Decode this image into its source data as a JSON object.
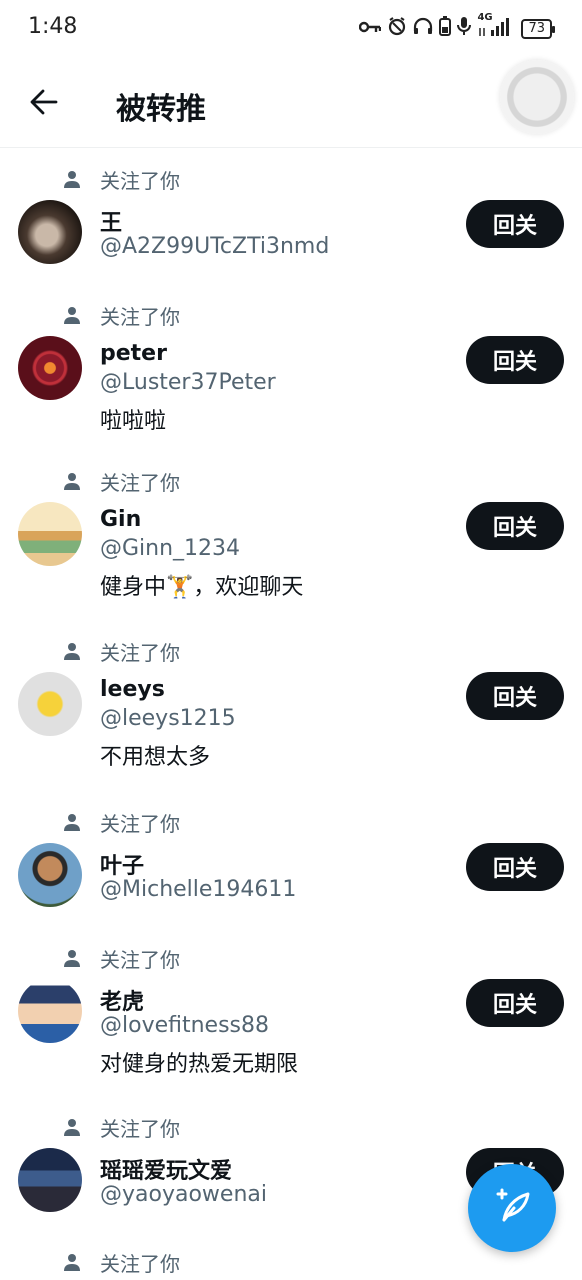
{
  "status_bar": {
    "time": "1:48",
    "network": "4G",
    "battery": "73",
    "icons": [
      "key-icon",
      "alarm-icon",
      "headphones-icon",
      "battery-saver-icon",
      "mic-icon",
      "signal-icon",
      "battery-icon"
    ]
  },
  "header": {
    "title": "被转推",
    "back_icon": "arrow-left-icon"
  },
  "follow_note_text": "关注了你",
  "follow_button_label": "回关",
  "users": [
    {
      "name": "王",
      "handle": "@A2Z99UTcZTi3nmd",
      "bio": ""
    },
    {
      "name": "peter",
      "handle": "@Luster37Peter",
      "bio": "啦啦啦"
    },
    {
      "name": "Gin",
      "handle": "@Ginn_1234",
      "bio": "健身中🏋，欢迎聊天"
    },
    {
      "name": "leeys",
      "handle": "@leeys1215",
      "bio": "不用想太多"
    },
    {
      "name": "叶子",
      "handle": "@Michelle194611",
      "bio": ""
    },
    {
      "name": "老虎",
      "handle": "@lovefitness88",
      "bio": "对健身的热爱无期限"
    },
    {
      "name": "瑶瑶爱玩文爱",
      "handle": "@yaoyaowenai",
      "bio": ""
    },
    {
      "name": "",
      "handle": "",
      "bio": ""
    }
  ],
  "fab": {
    "icon": "compose-feather-plus-icon"
  },
  "colors": {
    "accent": "#1d9bf0",
    "button": "#0f1419",
    "secondary_text": "#536471"
  }
}
